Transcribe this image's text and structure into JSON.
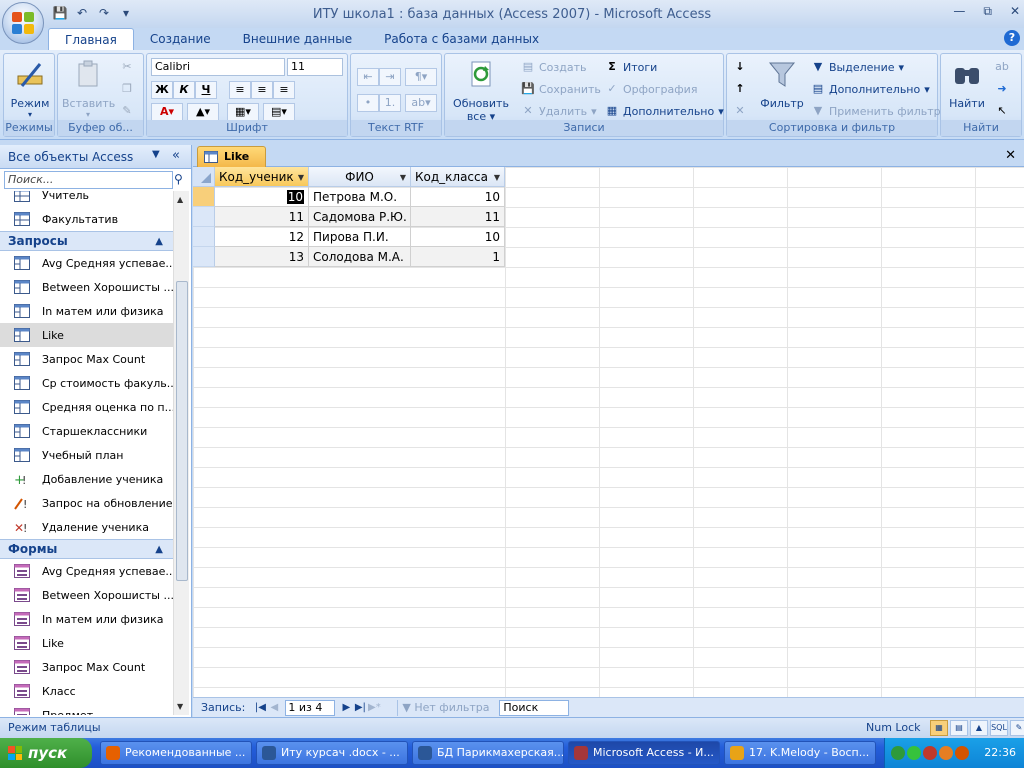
{
  "window": {
    "title": "ИТУ школа1 : база данных (Access 2007) - Microsoft Access"
  },
  "ribbon_tabs": [
    "Главная",
    "Создание",
    "Внешние данные",
    "Работа с базами данных"
  ],
  "ribbon": {
    "groups": {
      "modes": "Режимы",
      "clipboard": "Буфер об...",
      "font": "Шрифт",
      "rtf": "Текст RTF",
      "records": "Записи",
      "sort_filter": "Сортировка и фильтр",
      "find": "Найти"
    },
    "mode_btn": "Режим",
    "paste_btn": "Вставить",
    "font_name": "Calibri",
    "font_size": "11",
    "bold": "Ж",
    "italic": "К",
    "underline": "Ч",
    "refresh_btn_1": "Обновить",
    "refresh_btn_2": "все",
    "create": "Создать",
    "save": "Сохранить",
    "delete": "Удалить",
    "totals": "Итоги",
    "spelling": "Орфография",
    "more": "Дополнительно",
    "filter_btn": "Фильтр",
    "selection": "Выделение",
    "advanced": "Дополнительно",
    "apply_filter": "Применить фильтр",
    "find_btn": "Найти"
  },
  "nav": {
    "header": "Все объекты Access",
    "search_placeholder": "Поиск...",
    "tables_tail": [
      "Учитель",
      "Факультатив"
    ],
    "queries_label": "Запросы",
    "queries": [
      "Avg Средняя успевае...",
      "Between Хорошисты ...",
      "In матем или физика",
      "Like",
      "Запрос Max Count",
      "Ср стоимость факуль...",
      "Средняя оценка по п...",
      "Старшеклассники",
      "Учебный план",
      "Добавление ученика",
      "Запрос на обновление",
      "Удаление ученика"
    ],
    "forms_label": "Формы",
    "forms": [
      "Avg Средняя успевае...",
      "Between Хорошисты ...",
      "In матем или физика",
      "Like",
      "Запрос Max Count",
      "Класс",
      "Предмет"
    ]
  },
  "doc": {
    "tab_label": "Like",
    "columns": [
      "Код_ученик",
      "ФИО",
      "Код_класса"
    ],
    "rows": [
      {
        "id": "10",
        "fio": "Петрова М.О.",
        "class": "10"
      },
      {
        "id": "11",
        "fio": "Садомова Р.Ю.",
        "class": "11"
      },
      {
        "id": "12",
        "fio": "Пирова П.И.",
        "class": "10"
      },
      {
        "id": "13",
        "fio": "Солодова М.А.",
        "class": "1"
      }
    ]
  },
  "recnav": {
    "label": "Запись:",
    "position": "1 из 4",
    "filter": "Нет фильтра",
    "search": "Поиск"
  },
  "status": {
    "mode": "Режим таблицы",
    "numlock": "Num Lock",
    "sql": "SQL"
  },
  "taskbar": {
    "start": "пуск",
    "tasks": [
      "Рекомендованные ...",
      "Иту курсач .docx - ...",
      "БД Парикмахерская...",
      "Microsoft Access - И...",
      "17. K.Melody - Восп..."
    ],
    "clock": "22:36"
  },
  "colors": {
    "accent": "#15428b",
    "active_tab": "#f8c85a",
    "taskbar": "#245edb"
  }
}
